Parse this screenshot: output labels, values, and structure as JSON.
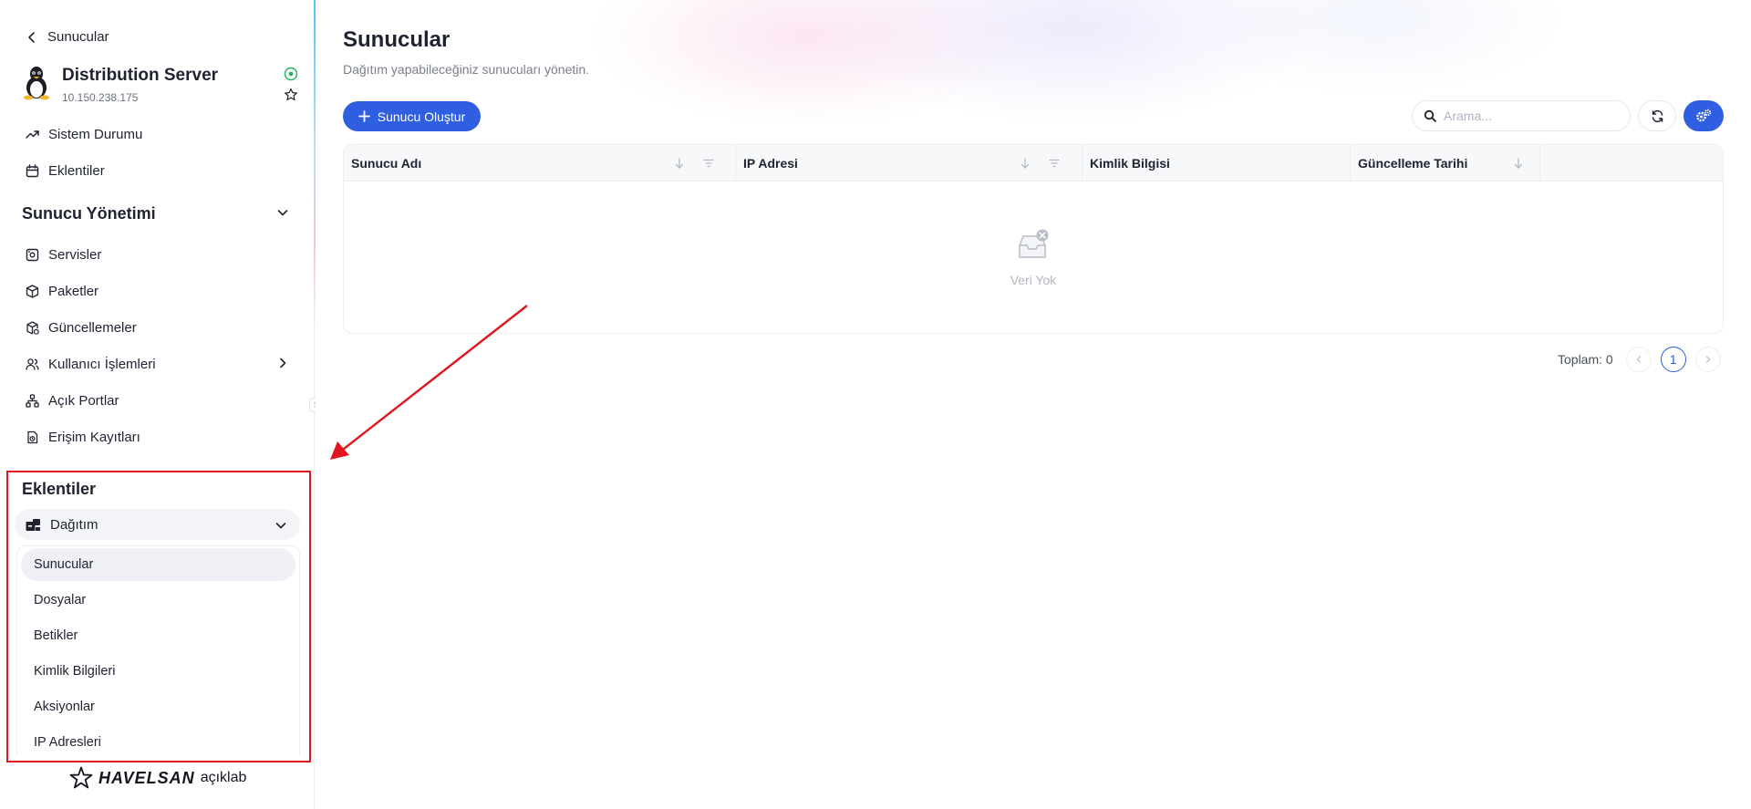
{
  "sidebar": {
    "back_label": "Sunucular",
    "server": {
      "name": "Distribution Server",
      "ip": "10.150.238.175"
    },
    "items": [
      {
        "label": "Sistem Durumu",
        "icon": "trending-up-icon"
      },
      {
        "label": "Eklentiler",
        "icon": "calendar-icon"
      }
    ],
    "section_title": "Sunucu Yönetimi",
    "section_items": [
      {
        "label": "Servisler",
        "icon": "server-icon"
      },
      {
        "label": "Paketler",
        "icon": "package-icon"
      },
      {
        "label": "Güncellemeler",
        "icon": "package-refresh-icon"
      },
      {
        "label": "Kullanıcı İşlemleri",
        "icon": "users-icon"
      },
      {
        "label": "Açık Portlar",
        "icon": "network-icon"
      },
      {
        "label": "Erişim Kayıtları",
        "icon": "logs-icon"
      }
    ],
    "plugins_title": "Eklentiler",
    "plugin_group": "Dağıtım",
    "plugin_items": [
      "Sunucular",
      "Dosyalar",
      "Betikler",
      "Kimlik Bilgileri",
      "Aksiyonlar",
      "IP Adresleri"
    ],
    "brand": {
      "name": "HAVELSAN",
      "suffix": "açıklab"
    }
  },
  "main": {
    "title": "Sunucular",
    "subtitle": "Dağıtım yapabileceğiniz sunucuları yönetin.",
    "create_button": "Sunucu Oluştur",
    "search_placeholder": "Arama...",
    "columns": [
      "Sunucu Adı",
      "IP Adresi",
      "Kimlik Bilgisi",
      "Güncelleme Tarihi"
    ],
    "empty_text": "Veri Yok",
    "total_label": "Toplam: 0",
    "current_page": "1"
  },
  "colors": {
    "primary": "#2f5fe0",
    "annotation": "#e0161e",
    "status_online": "#22b35e"
  }
}
